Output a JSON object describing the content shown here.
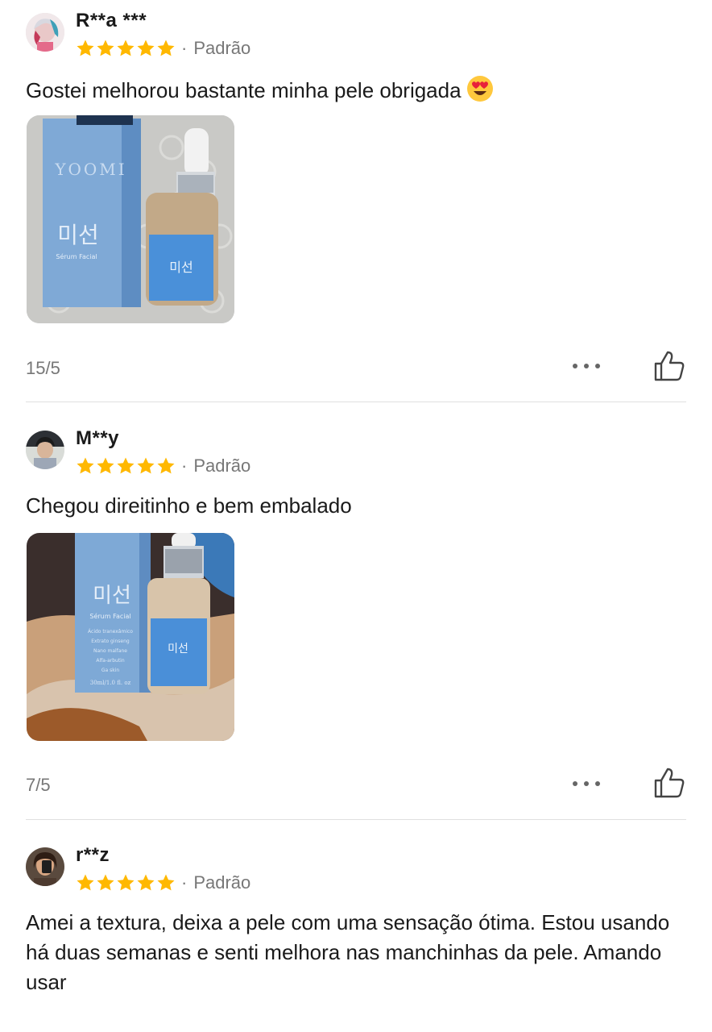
{
  "reviews": [
    {
      "username": "R**a ***",
      "rating": 5,
      "variant": "Padrão",
      "text": "Gostei melhorou bastante minha pele obrigada",
      "emoji": "smiling-face-with-heart-eyes",
      "has_photo": true,
      "photo_labels": {
        "brand": "YOOMI",
        "korean": "미선",
        "product": "Sérum Facial"
      },
      "date": "15/5"
    },
    {
      "username": "M**y",
      "rating": 5,
      "variant": "Padrão",
      "text": "Chegou direitinho e bem embalado",
      "has_photo": true,
      "photo_labels": {
        "korean": "미선",
        "product": "Sérum Facial",
        "ingredients": [
          "Ácido tranexâmico",
          "Extrato ginseng",
          "Nano malfane",
          "Alfa-arbutin",
          "Ga skin"
        ],
        "volume": "30ml/1.0 fl. oz"
      },
      "date": "7/5"
    },
    {
      "username": "r**z",
      "rating": 5,
      "variant": "Padrão",
      "text": "Amei a textura, deixa a pele com uma sensação ótima.  Estou usando há duas semanas e senti melhora nas manchinhas da pele. Amando usar"
    }
  ],
  "icons": {
    "star": "star-filled-icon",
    "more": "more-dots-icon",
    "like": "thumbs-up-icon"
  },
  "colors": {
    "star": "#FFB800",
    "muted": "#777777",
    "divider": "#E0E0E0",
    "text": "#1A1A1A"
  }
}
